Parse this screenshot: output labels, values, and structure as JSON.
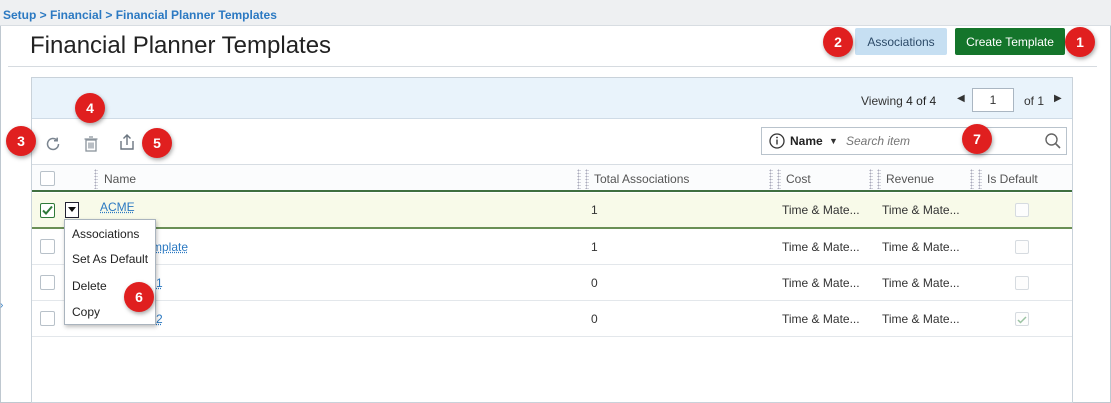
{
  "breadcrumb": "Setup > Financial > Financial Planner Templates",
  "page_title": "Financial Planner Templates",
  "buttons": {
    "associations": "Associations",
    "create_template": "Create Template"
  },
  "pagination": {
    "viewing_label": "Viewing",
    "viewing_value": "4 of 4",
    "page_value": "1",
    "of_label": "of 1",
    "prev_glyph": "◀",
    "next_glyph": "▶"
  },
  "search": {
    "field": "Name",
    "caret": "▼",
    "placeholder": "Search item"
  },
  "table": {
    "columns": [
      "Name",
      "Total Associations",
      "Cost",
      "Revenue",
      "Is Default"
    ],
    "rows": [
      {
        "name": "ACME",
        "total": "1",
        "cost": "Time & Mate...",
        "revenue": "Time & Mate...",
        "selected": true,
        "is_default": false
      },
      {
        "name": "mplate",
        "total": "1",
        "cost": "Time & Mate...",
        "revenue": "Time & Mate...",
        "selected": false,
        "is_default": false
      },
      {
        "name": "1",
        "total": "0",
        "cost": "Time & Mate...",
        "revenue": "Time & Mate...",
        "selected": false,
        "is_default": false
      },
      {
        "name": "2",
        "total": "0",
        "cost": "Time & Mate...",
        "revenue": "Time & Mate...",
        "selected": false,
        "is_default": true
      }
    ]
  },
  "row_menu": [
    "Associations",
    "Set As Default",
    "Delete",
    "Copy"
  ],
  "callouts": [
    "1",
    "2",
    "3",
    "4",
    "5",
    "6",
    "7"
  ],
  "colors": {
    "accent_green": "#14752b",
    "link_blue": "#2b79c2",
    "badge_red": "#e01f1f",
    "light_button": "#c6dff2"
  },
  "icons": [
    "refresh-icon",
    "trash-icon",
    "export-icon",
    "info-icon",
    "search-icon",
    "dropdown-caret-icon",
    "checkmark-icon"
  ]
}
